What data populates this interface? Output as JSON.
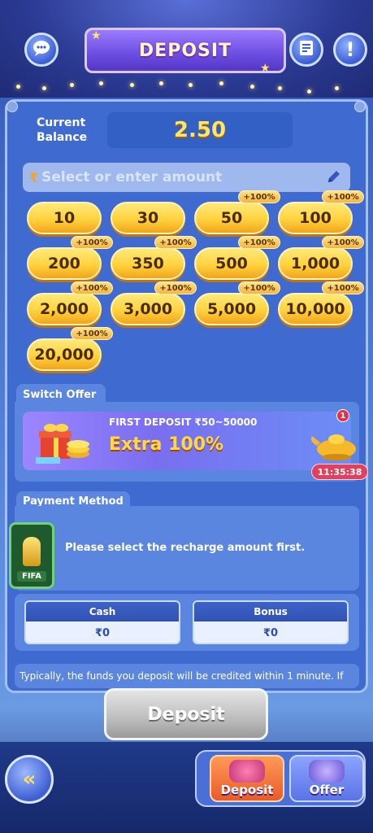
{
  "header": {
    "title": "DEPOSIT",
    "buttons": [
      "support-icon",
      "records-icon",
      "info-icon"
    ]
  },
  "balance": {
    "label": "Current Balance",
    "value": "2.50"
  },
  "amount_input": {
    "currency_symbol": "₹",
    "placeholder": "Select or enter amount"
  },
  "amounts": [
    {
      "value": "10",
      "bonus": ""
    },
    {
      "value": "30",
      "bonus": ""
    },
    {
      "value": "50",
      "bonus": "+100%"
    },
    {
      "value": "100",
      "bonus": "+100%"
    },
    {
      "value": "200",
      "bonus": "+100%"
    },
    {
      "value": "350",
      "bonus": "+100%"
    },
    {
      "value": "500",
      "bonus": "+100%"
    },
    {
      "value": "1,000",
      "bonus": "+100%"
    },
    {
      "value": "2,000",
      "bonus": "+100%"
    },
    {
      "value": "3,000",
      "bonus": "+100%"
    },
    {
      "value": "5,000",
      "bonus": "+100%"
    },
    {
      "value": "10,000",
      "bonus": "+100%"
    },
    {
      "value": "20,000",
      "bonus": "+100%"
    }
  ],
  "switch_offer": {
    "tab_label": "Switch Offer",
    "title": "FIRST DEPOSIT ₹50~50000",
    "extra": "Extra 100%",
    "timer": "11:35:38",
    "badge": "1"
  },
  "payment_method": {
    "tab_label": "Payment Method",
    "logo_text": "FIFA",
    "message": "Please select the recharge amount first."
  },
  "wallet": {
    "cash_label": "Cash",
    "cash_value": "₹0",
    "bonus_label": "Bonus",
    "bonus_value": "₹0"
  },
  "note": "Typically, the funds you deposit will be credited within 1 minute. If",
  "deposit_button": "Deposit",
  "bottom_tabs": [
    {
      "label": "Deposit",
      "active": true
    },
    {
      "label": "Offer",
      "active": false
    }
  ],
  "back_icon": "«"
}
